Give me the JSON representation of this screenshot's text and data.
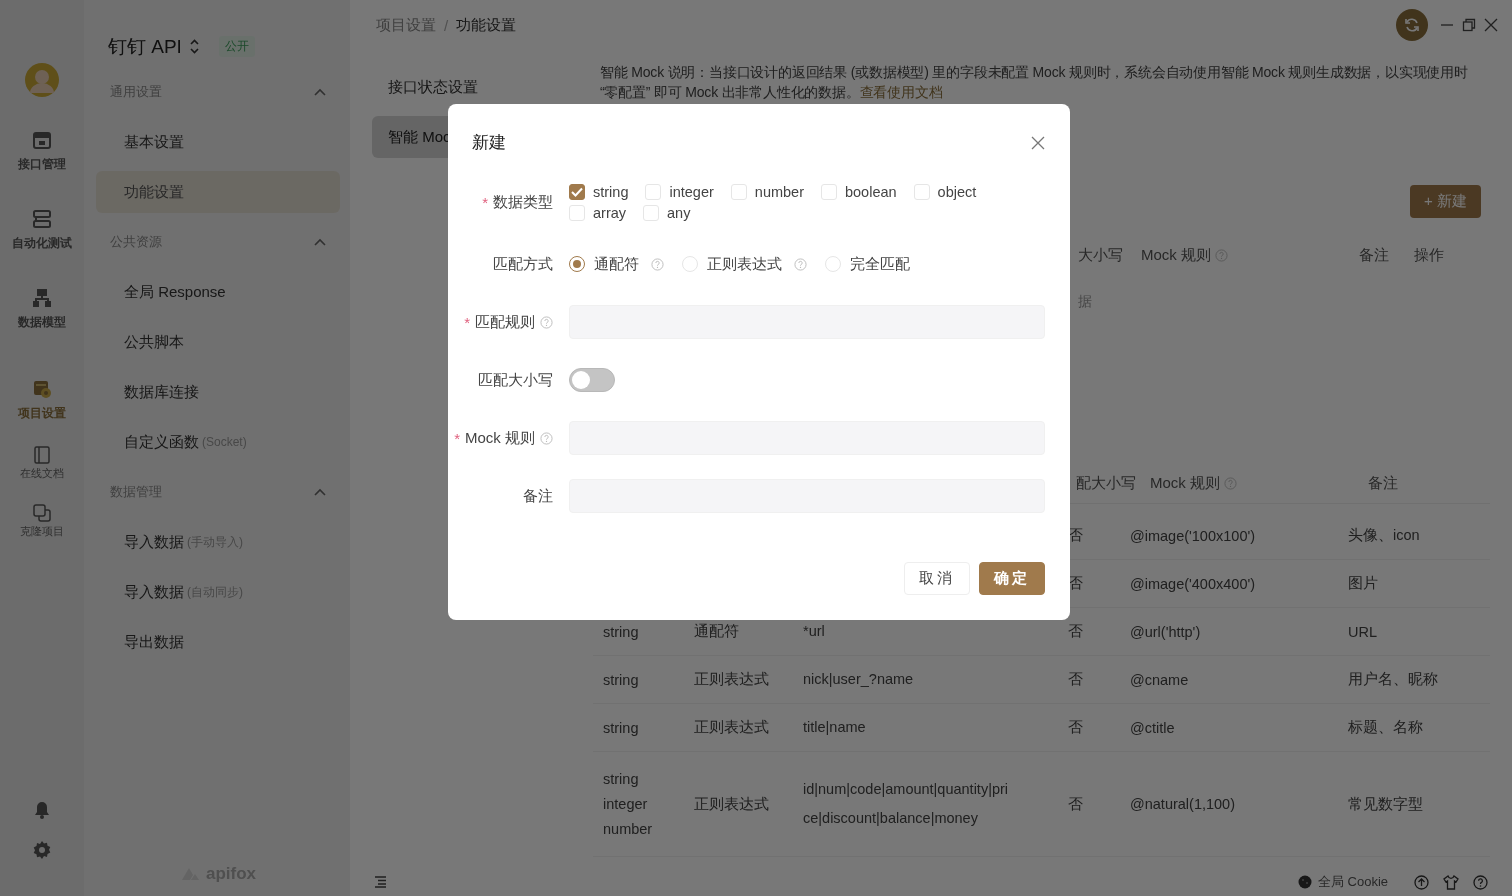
{
  "rail": {
    "items": [
      {
        "label": "接口管理",
        "kind": "main",
        "selected": false
      },
      {
        "label": "自动化测试",
        "kind": "main",
        "selected": false
      },
      {
        "label": "数据模型",
        "kind": "main",
        "selected": false
      },
      {
        "label": "项目设置",
        "kind": "main",
        "selected": true
      },
      {
        "label": "在线文档",
        "kind": "minor",
        "selected": false
      },
      {
        "label": "克隆项目",
        "kind": "minor",
        "selected": false
      }
    ]
  },
  "sidebar": {
    "project": "钉钉 API",
    "badge": "公开",
    "groups": [
      {
        "title": "通用设置",
        "expanded": true,
        "items": [
          {
            "label": "基本设置",
            "selected": false
          },
          {
            "label": "功能设置",
            "selected": true
          }
        ]
      },
      {
        "title": "公共资源",
        "expanded": true,
        "items": [
          {
            "label": "全局 Response",
            "selected": false
          },
          {
            "label": "公共脚本",
            "selected": false
          },
          {
            "label": "数据库连接",
            "selected": false
          },
          {
            "label": "自定义函数",
            "note": "(Socket)",
            "selected": false
          }
        ]
      },
      {
        "title": "数据管理",
        "expanded": true,
        "items": [
          {
            "label": "导入数据",
            "note": "(手动导入)",
            "selected": false
          },
          {
            "label": "导入数据",
            "note": "(自动同步)",
            "selected": false
          },
          {
            "label": "导出数据",
            "selected": false
          }
        ]
      }
    ],
    "brand": "apifox"
  },
  "breadcrumb": {
    "items": [
      "项目设置",
      "功能设置"
    ],
    "separator": "/"
  },
  "subnav": [
    {
      "label": "接口状态设置",
      "selected": false
    },
    {
      "label": "智能 Moc",
      "selected": true
    }
  ],
  "notice": {
    "text": "智能 Mock 说明：当接口设计的返回结果 (或数据模型) 里的字段未配置 Mock 规则时，系统会自动使用智能 Mock 规则生成数据，以实现使用时 “零配置” 即可 Mock 出非常人性化的数据。",
    "link": "查看使用文档"
  },
  "new_button": "+ 新建",
  "custom_table": {
    "columns": [
      {
        "label": "大小写"
      },
      {
        "label": "Mock 规则",
        "help": true
      },
      {
        "label": "备注"
      },
      {
        "label": "操作"
      }
    ],
    "empty_text": "据"
  },
  "builtin_table": {
    "columns": [
      {
        "label": "配大小写"
      },
      {
        "label": "Mock 规则",
        "help": true
      },
      {
        "label": "备注"
      }
    ],
    "rows": [
      {
        "case": "否",
        "mock": "@image('100x100')",
        "note": "头像、icon"
      },
      {
        "case": "否",
        "mock": "@image('400x400')",
        "note": "图片"
      },
      {
        "types": [
          "string"
        ],
        "match": "通配符",
        "pattern": "*url",
        "case": "否",
        "mock": "@url('http')",
        "note": "URL"
      },
      {
        "types": [
          "string"
        ],
        "match": "正则表达式",
        "pattern": "nick|user_?name",
        "case": "否",
        "mock": "@cname",
        "note": "用户名、昵称"
      },
      {
        "types": [
          "string"
        ],
        "match": "正则表达式",
        "pattern": "title|name",
        "case": "否",
        "mock": "@ctitle",
        "note": "标题、名称"
      },
      {
        "types": [
          "string",
          "integer",
          "number"
        ],
        "match": "正则表达式",
        "pattern": "id|num|code|amount|quantity|price|discount|balance|money",
        "case": "否",
        "mock": "@natural(1,100)",
        "note": "常见数字型"
      }
    ]
  },
  "status_bar": {
    "cookie": "全局 Cookie"
  },
  "modal": {
    "title": "新建",
    "required_mark": "*",
    "fields": [
      {
        "kind": "checkboxes",
        "label": "数据类型",
        "required": true,
        "options": [
          {
            "label": "string",
            "checked": true
          },
          {
            "label": "integer",
            "checked": false
          },
          {
            "label": "number",
            "checked": false
          },
          {
            "label": "boolean",
            "checked": false
          },
          {
            "label": "object",
            "checked": false
          },
          {
            "label": "array",
            "checked": false
          },
          {
            "label": "any",
            "checked": false
          }
        ]
      },
      {
        "kind": "radios",
        "label": "匹配方式",
        "required": false,
        "options": [
          {
            "label": "通配符",
            "selected": true,
            "help": true
          },
          {
            "label": "正则表达式",
            "selected": false,
            "help": true
          },
          {
            "label": "完全匹配",
            "selected": false
          }
        ]
      },
      {
        "kind": "input",
        "label": "匹配规则",
        "required": true,
        "help": true
      },
      {
        "kind": "switch",
        "label": "匹配大小写",
        "required": false,
        "on": false
      },
      {
        "kind": "input",
        "label": "Mock 规则",
        "required": true,
        "help": true
      },
      {
        "kind": "input",
        "label": "备注",
        "required": false
      }
    ],
    "buttons": [
      {
        "label": "取消",
        "kind": "default"
      },
      {
        "label": "确定",
        "kind": "primary"
      }
    ]
  }
}
